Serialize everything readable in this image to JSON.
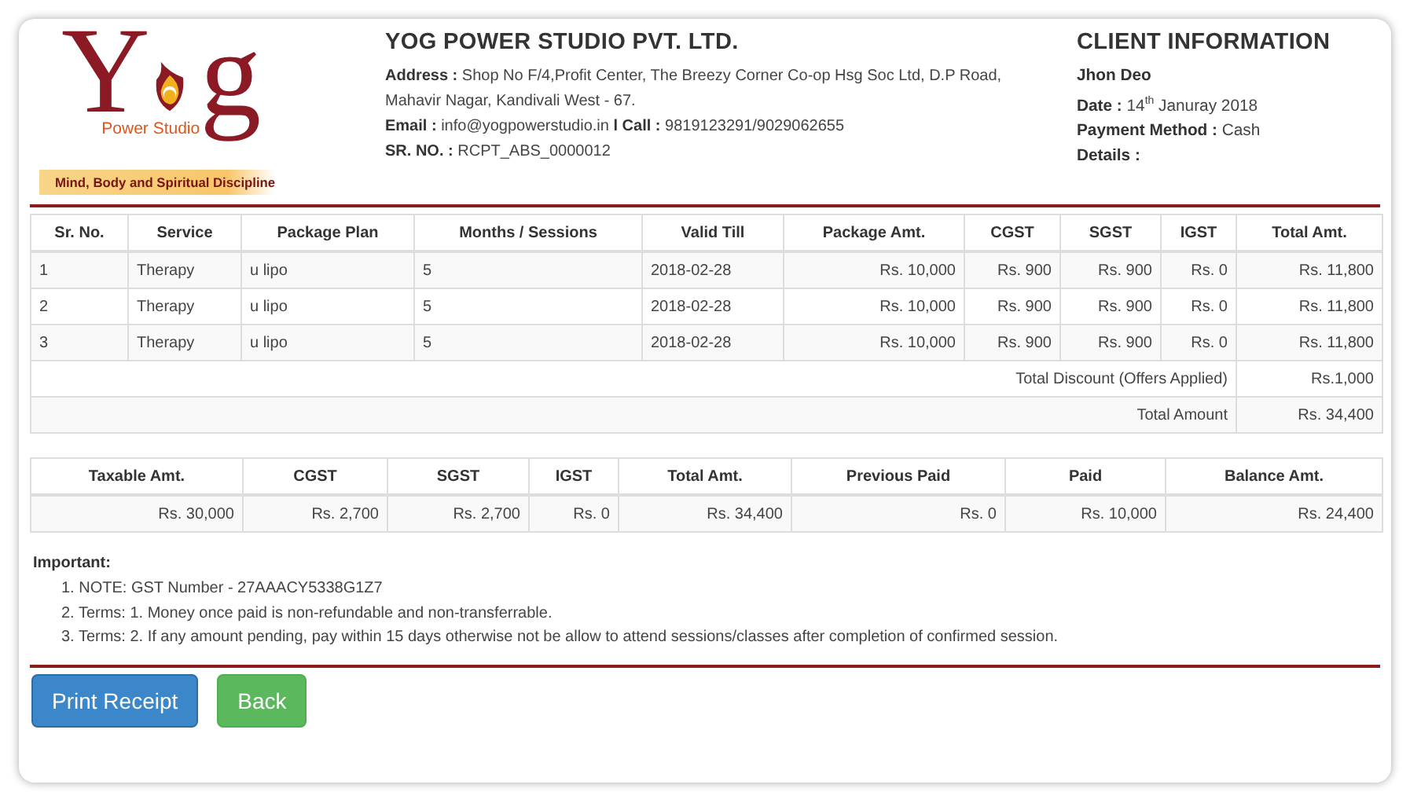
{
  "logo": {
    "letter_1": "Y",
    "letter_2": "g",
    "subtitle": "Power Studio",
    "tagline": "Mind, Body and Spiritual Discipline"
  },
  "company": {
    "name": "YOG POWER STUDIO PVT. LTD.",
    "lines": [
      "**Address :** Shop No F/4,Profit Center, The Breezy Corner Co-op Hsg Soc Ltd, D.P Road,",
      "Mahavir Nagar, Kandivali West - 67.",
      "**Email :** info@yogpowerstudio.in **l Call :** 9819123291/9029062655",
      "**SR. NO. :** RCPT_ABS_0000012"
    ]
  },
  "client": {
    "title": "CLIENT INFORMATION",
    "lines": [
      "**Jhon Deo**",
      "**Date :** 14$^{th}$ Januray 2018",
      "**Payment Method :** Cash",
      "**Details :**"
    ]
  },
  "items_table": {
    "columns": [
      {
        "label": "Sr. No.",
        "kind": "text"
      },
      {
        "label": "Service",
        "kind": "text"
      },
      {
        "label": "Package Plan",
        "kind": "text"
      },
      {
        "label": "Months / Sessions",
        "kind": "text"
      },
      {
        "label": "Valid Till",
        "kind": "text"
      },
      {
        "label": "Package Amt.",
        "kind": "amount"
      },
      {
        "label": "CGST",
        "kind": "amount"
      },
      {
        "label": "SGST",
        "kind": "amount"
      },
      {
        "label": "IGST",
        "kind": "amount"
      },
      {
        "label": "Total Amt.",
        "kind": "amount"
      }
    ],
    "rows": [
      [
        "1",
        "Therapy",
        "u lipo",
        "5",
        "2018-02-28",
        "Rs. 10,000",
        "Rs. 900",
        "Rs. 900",
        "Rs. 0",
        "Rs. 11,800"
      ],
      [
        "2",
        "Therapy",
        "u lipo",
        "5",
        "2018-02-28",
        "Rs. 10,000",
        "Rs. 900",
        "Rs. 900",
        "Rs. 0",
        "Rs. 11,800"
      ],
      [
        "3",
        "Therapy",
        "u lipo",
        "5",
        "2018-02-28",
        "Rs. 10,000",
        "Rs. 900",
        "Rs. 900",
        "Rs. 0",
        "Rs. 11,800"
      ]
    ],
    "summary": [
      {
        "label": "Total Discount (Offers Applied)",
        "value": "Rs.1,000"
      },
      {
        "label": "Total Amount",
        "value": "Rs. 34,400"
      }
    ]
  },
  "totals_table": {
    "columns": [
      {
        "label": "Taxable Amt.",
        "kind": "amount"
      },
      {
        "label": "CGST",
        "kind": "amount"
      },
      {
        "label": "SGST",
        "kind": "amount"
      },
      {
        "label": "IGST",
        "kind": "amount"
      },
      {
        "label": "Total Amt.",
        "kind": "amount"
      },
      {
        "label": "Previous Paid",
        "kind": "amount"
      },
      {
        "label": "Paid",
        "kind": "amount"
      },
      {
        "label": "Balance Amt.",
        "kind": "amount"
      }
    ],
    "rows": [
      [
        "Rs. 30,000",
        "Rs. 2,700",
        "Rs. 2,700",
        "Rs. 0",
        "Rs. 34,400",
        "Rs. 0",
        "Rs. 10,000",
        "Rs. 24,400"
      ]
    ]
  },
  "notes": {
    "title": "Important:",
    "items": [
      "1. NOTE: GST Number - 27AAACY5338G1Z7",
      "2. Terms: 1. Money once paid is non-refundable and non-transferrable.",
      "3. Terms: 2. If any amount pending, pay within 15 days otherwise not be allow to attend sessions/classes after completion of confirmed session."
    ]
  },
  "buttons": [
    {
      "label": "Print Receipt",
      "kind": "primary"
    },
    {
      "label": "Back",
      "kind": "success"
    }
  ]
}
